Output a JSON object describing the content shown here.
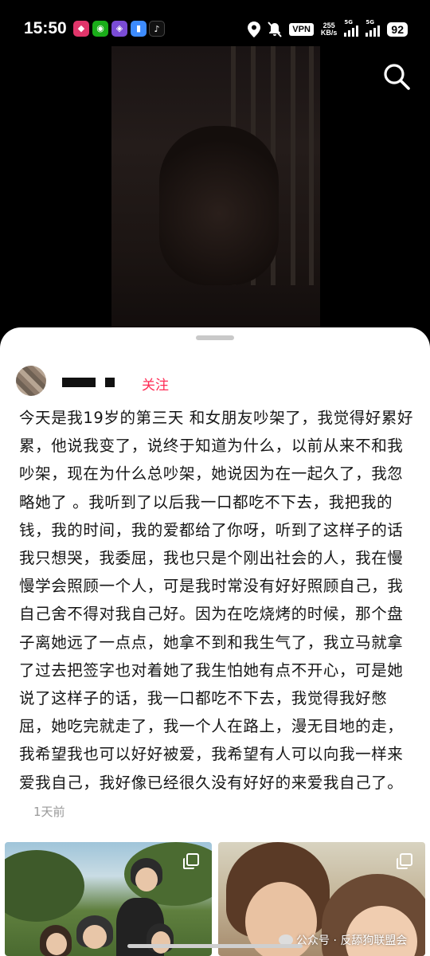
{
  "status_bar": {
    "time": "15:50",
    "vpn": "VPN",
    "speed_value": "255",
    "speed_unit": "KB/s",
    "signal1_label": "5G",
    "signal2_label": "5G",
    "battery": "92"
  },
  "post": {
    "follow_label": "关注",
    "text": "今天是我19岁的第三天 和女朋友吵架了，我觉得好累好累，他说我变了，说终于知道为什么，以前从来不和我吵架，现在为什么总吵架，她说因为在一起久了，我忽略她了 。我听到了以后我一口都吃不下去，我把我的钱，我的时间，我的爱都给了你呀，听到了这样子的话我只想哭，我委屈，我也只是个刚出社会的人，我在慢慢学会照顾一个人，可是我时常没有好好照顾自己，我自己舍不得对我自己好。因为在吃烧烤的时候，那个盘子离她远了一点点，她拿不到和我生气了，我立马就拿了过去把签字也对着她了我生怕她有点不开心，可是她说了这样子的话，我一口都吃不下去，我觉得我好憋屈，她吃完就走了，我一个人在路上，漫无目地的走，我希望我也可以好好被爱，我希望有人可以向我一样来爱我自己，我好像已经很久没有好好的来爱我自己了。",
    "timestamp": "1天前"
  },
  "watermark": "公众号 · 反舔狗联盟会",
  "icons": {
    "search": "search-icon",
    "location": "location-icon",
    "mute": "mute-icon",
    "multi_image": "multi-image-icon"
  }
}
